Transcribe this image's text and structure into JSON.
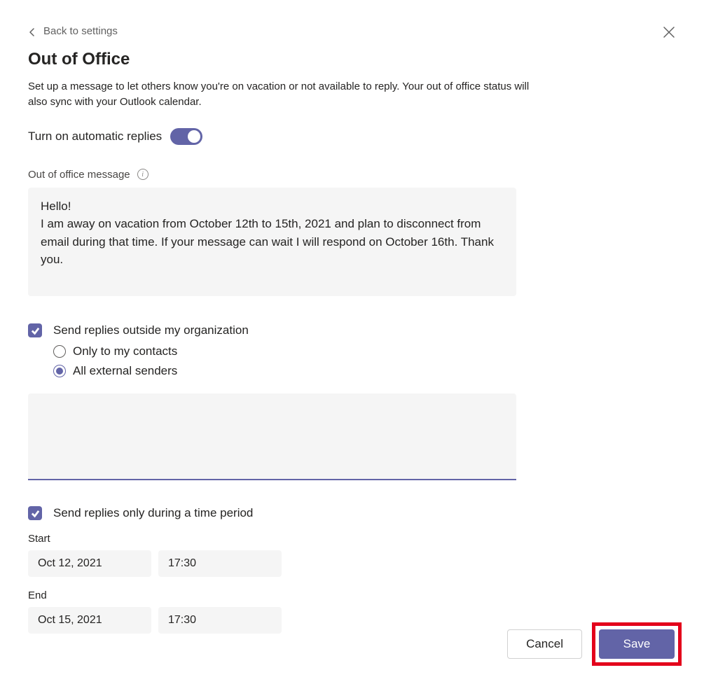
{
  "back": {
    "label": "Back to settings"
  },
  "title": "Out of Office",
  "description": "Set up a message to let others know you're on vacation or not available to reply. Your out of office status will also sync with your Outlook calendar.",
  "toggle": {
    "label": "Turn on automatic replies",
    "on": true
  },
  "message": {
    "label": "Out of office message",
    "value": "Hello!\nI am away on vacation from October 12th to 15th, 2021 and plan to disconnect from email during that time. If your message can wait I will respond on October 16th. Thank you."
  },
  "outside": {
    "label": "Send replies outside my organization",
    "checked": true,
    "options": {
      "contacts": "Only to my contacts",
      "all": "All external senders",
      "selected": "all"
    },
    "external_message": ""
  },
  "time_period": {
    "label": "Send replies only during a time period",
    "checked": true,
    "start_label": "Start",
    "end_label": "End",
    "start_date": "Oct 12, 2021",
    "start_time": "17:30",
    "end_date": "Oct 15, 2021",
    "end_time": "17:30"
  },
  "footer": {
    "cancel": "Cancel",
    "save": "Save"
  },
  "colors": {
    "accent": "#6264a7",
    "highlight": "#e3001b"
  }
}
